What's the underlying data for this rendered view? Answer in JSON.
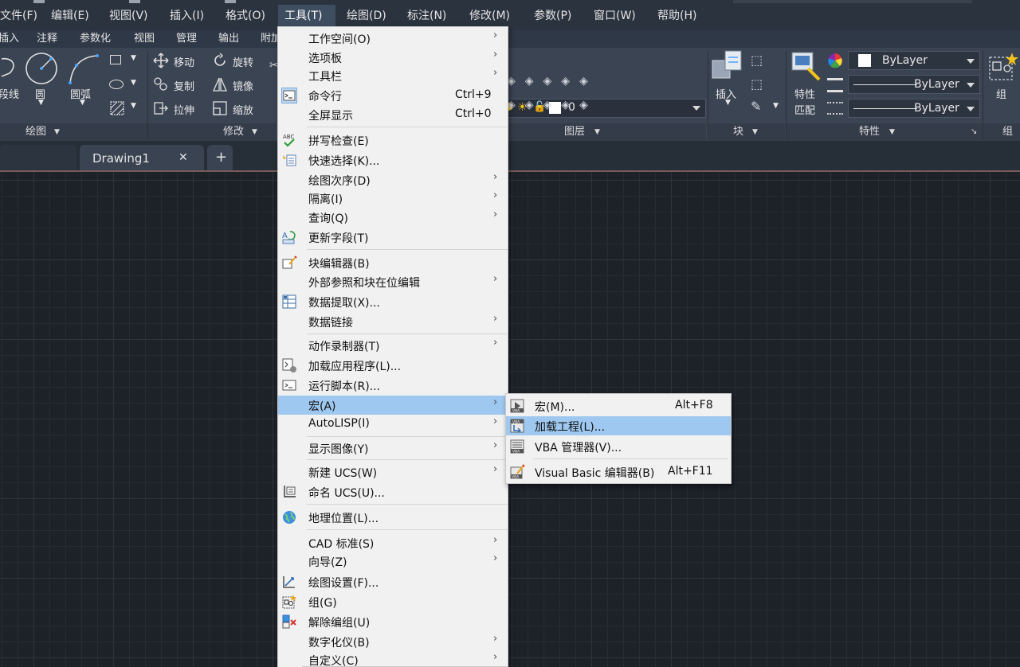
{
  "menubar": {
    "items": [
      {
        "label": "文件(F)"
      },
      {
        "label": "编辑(E)"
      },
      {
        "label": "视图(V)"
      },
      {
        "label": "插入(I)"
      },
      {
        "label": "格式(O)"
      },
      {
        "label": "工具(T)"
      },
      {
        "label": "绘图(D)"
      },
      {
        "label": "标注(N)"
      },
      {
        "label": "修改(M)"
      },
      {
        "label": "参数(P)"
      },
      {
        "label": "窗口(W)"
      },
      {
        "label": "帮助(H)"
      }
    ]
  },
  "ribbon_tabs": [
    "插入",
    "注释",
    "参数化",
    "视图",
    "管理",
    "输出",
    "附加"
  ],
  "ribbon": {
    "draw": {
      "polyline": "段线",
      "circle": "圆",
      "arc": "圆弧",
      "title": "绘图"
    },
    "modify": {
      "move": "移动",
      "rotate": "旋转",
      "copy": "复制",
      "mirror": "镜像",
      "stretch": "拉伸",
      "scale": "缩放",
      "title": "修改"
    },
    "layers": {
      "current_layer": "0",
      "title": "图层"
    },
    "block": {
      "insert": "插入",
      "title": "块"
    },
    "properties": {
      "match": "特性匹配",
      "match_line1": "特性",
      "match_line2": "匹配",
      "color": "ByLayer",
      "linetype": "ByLayer",
      "lineweight": "ByLayer",
      "title": "特性"
    },
    "groups": {
      "group": "组",
      "title": "组"
    }
  },
  "filetabs": {
    "tab1": "Drawing1",
    "close": "✕",
    "add": "+"
  },
  "tools_menu": {
    "items": [
      {
        "label": "工作空间(O)",
        "shortcut": "",
        "sub": true
      },
      {
        "label": "选项板",
        "shortcut": "",
        "sub": true
      },
      {
        "label": "工具栏",
        "shortcut": "",
        "sub": true
      },
      {
        "label": "命令行",
        "shortcut": "Ctrl+9",
        "sub": false
      },
      {
        "label": "全屏显示",
        "shortcut": "Ctrl+0",
        "sub": false
      },
      {
        "label": "拼写检查(E)",
        "shortcut": "",
        "sub": false
      },
      {
        "label": "快速选择(K)...",
        "shortcut": "",
        "sub": false
      },
      {
        "label": "绘图次序(D)",
        "shortcut": "",
        "sub": true
      },
      {
        "label": "隔离(I)",
        "shortcut": "",
        "sub": true
      },
      {
        "label": "查询(Q)",
        "shortcut": "",
        "sub": true
      },
      {
        "label": "更新字段(T)",
        "shortcut": "",
        "sub": false
      },
      {
        "label": "块编辑器(B)",
        "shortcut": "",
        "sub": false
      },
      {
        "label": "外部参照和块在位编辑",
        "shortcut": "",
        "sub": true
      },
      {
        "label": "数据提取(X)...",
        "shortcut": "",
        "sub": false
      },
      {
        "label": "数据链接",
        "shortcut": "",
        "sub": true
      },
      {
        "label": "动作录制器(T)",
        "shortcut": "",
        "sub": true
      },
      {
        "label": "加载应用程序(L)...",
        "shortcut": "",
        "sub": false
      },
      {
        "label": "运行脚本(R)...",
        "shortcut": "",
        "sub": false
      },
      {
        "label": "宏(A)",
        "shortcut": "",
        "sub": true
      },
      {
        "label": "AutoLISP(I)",
        "shortcut": "",
        "sub": true
      },
      {
        "label": "显示图像(Y)",
        "shortcut": "",
        "sub": true
      },
      {
        "label": "新建 UCS(W)",
        "shortcut": "",
        "sub": true
      },
      {
        "label": "命名 UCS(U)...",
        "shortcut": "",
        "sub": false
      },
      {
        "label": "地理位置(L)...",
        "shortcut": "",
        "sub": false
      },
      {
        "label": "CAD 标准(S)",
        "shortcut": "",
        "sub": true
      },
      {
        "label": "向导(Z)",
        "shortcut": "",
        "sub": true
      },
      {
        "label": "绘图设置(F)...",
        "shortcut": "",
        "sub": false
      },
      {
        "label": "组(G)",
        "shortcut": "",
        "sub": false
      },
      {
        "label": "解除编组(U)",
        "shortcut": "",
        "sub": false
      },
      {
        "label": "数字化仪(B)",
        "shortcut": "",
        "sub": true
      },
      {
        "label": "自定义(C)",
        "shortcut": "",
        "sub": true
      }
    ],
    "submenu_arrow": "›"
  },
  "macro_menu": {
    "items": [
      {
        "label": "宏(M)...",
        "shortcut": "Alt+F8"
      },
      {
        "label": "加载工程(L)...",
        "shortcut": ""
      },
      {
        "label": "VBA 管理器(V)...",
        "shortcut": ""
      },
      {
        "label": "Visual Basic 编辑器(B)",
        "shortcut": "Alt+F11"
      }
    ]
  },
  "colors": {
    "menu_highlight": "#9ec8f0",
    "menubar_bg": "#2b333f",
    "ribbon_bg": "#3b4453",
    "canvas_bg": "#1d2228"
  }
}
